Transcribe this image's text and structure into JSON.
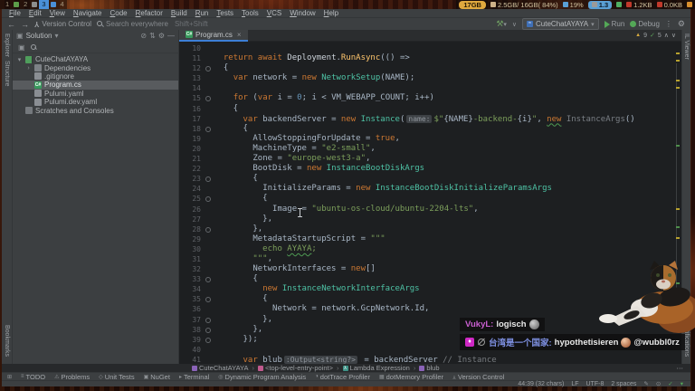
{
  "colors": {
    "accent_blue": "#3d7fd6",
    "run_green": "#54a857",
    "warning_yellow": "#d6a93f",
    "badge_magenta": "#cf28c4",
    "active_workspace_blue": "#4a90d9"
  },
  "desktop_panel": {
    "workspaces": [
      {
        "label": "1",
        "active": false
      },
      {
        "label": "2",
        "active": false
      },
      {
        "label": "3",
        "active": true
      },
      {
        "label": "4",
        "active": false
      }
    ],
    "workspace_icons": [
      "plant-icon",
      "monitor-icon",
      "document-icon"
    ],
    "stats": [
      {
        "icon": "disk-icon",
        "text": "17GB",
        "variant": "yellow"
      },
      {
        "icon": "memory-icon",
        "text": "2.5GB/ 16GB( 84%)",
        "variant": ""
      },
      {
        "icon": "cpu-icon",
        "text": "19%",
        "variant": ""
      },
      {
        "icon": "load-icon",
        "text": "1.3",
        "variant": "blue"
      },
      {
        "icon": "network-icon",
        "text": "",
        "variant": ""
      },
      {
        "icon": "download-icon",
        "text": "1.2KB",
        "variant": ""
      },
      {
        "icon": "upload-icon",
        "text": "0.0KB",
        "variant": ""
      },
      {
        "icon": "power-icon",
        "text": "",
        "variant": ""
      }
    ]
  },
  "menubar": {
    "items": [
      "File",
      "Edit",
      "View",
      "Navigate",
      "Code",
      "Refactor",
      "Build",
      "Run",
      "Tests",
      "Tools",
      "VCS",
      "Window",
      "Help"
    ]
  },
  "toolbar": {
    "back": "←",
    "forward": "→",
    "version_control_label": "Version Control",
    "search_placeholder": "Search everywhere",
    "search_shortcut": "Shift+Shift",
    "build_chevron": "∨",
    "run_config": "CuteChatAYAYA",
    "config_caret": "▾",
    "run_label": "Run",
    "debug_label": "Debug",
    "more_dots": "⋮"
  },
  "left_stripe": {
    "top": [
      "Explorer",
      "Structure"
    ],
    "bottom": [
      "Bookmarks"
    ]
  },
  "right_stripe": {
    "top": [
      "IL Viewer"
    ],
    "bottom": [
      "Notifications"
    ]
  },
  "solution_panel": {
    "title": "Solution",
    "title_caret": "▾",
    "tree": [
      {
        "label": "CuteChatAYAYA",
        "icon": "solution",
        "indent": 0,
        "chevron": "▾",
        "selected": false
      },
      {
        "label": "Dependencies",
        "icon": "dependencies",
        "indent": 1,
        "chevron": "›",
        "selected": false
      },
      {
        "label": ".gitignore",
        "icon": "file",
        "indent": 1,
        "chevron": "",
        "selected": false
      },
      {
        "label": "Program.cs",
        "icon": "csharp",
        "indent": 1,
        "chevron": "",
        "selected": true
      },
      {
        "label": "Pulumi.yaml",
        "icon": "file",
        "indent": 1,
        "chevron": "",
        "selected": false
      },
      {
        "label": "Pulumi.dev.yaml",
        "icon": "file",
        "indent": 1,
        "chevron": "",
        "selected": false
      },
      {
        "label": "Scratches and Consoles",
        "icon": "scratches",
        "indent": 0,
        "chevron": "",
        "selected": false
      }
    ]
  },
  "editor": {
    "tab": {
      "label": "Program.cs",
      "close": "×",
      "icon": "C#"
    },
    "inspections": {
      "warnings": "9",
      "passed": "5",
      "up": "∧",
      "down": "∨"
    },
    "lines": [
      {
        "n": 10,
        "t": []
      },
      {
        "n": 11,
        "t": [
          [
            "p",
            "  "
          ],
          [
            "k",
            "return"
          ],
          [
            "p",
            " "
          ],
          [
            "k",
            "await"
          ],
          [
            "p",
            " "
          ],
          [
            "t0",
            "Deployment"
          ],
          [
            "p",
            "."
          ],
          [
            "m",
            "RunAsync"
          ],
          [
            "p",
            "(() =>"
          ]
        ]
      },
      {
        "n": 12,
        "t": [
          [
            "p",
            "  {"
          ]
        ],
        "fold": true
      },
      {
        "n": 13,
        "t": [
          [
            "p",
            "    "
          ],
          [
            "k",
            "var"
          ],
          [
            "p",
            " "
          ],
          [
            "v",
            "network"
          ],
          [
            "p",
            " = "
          ],
          [
            "k",
            "new"
          ],
          [
            "p",
            " "
          ],
          [
            "t",
            "NetworkSetup"
          ],
          [
            "p",
            "("
          ],
          [
            "cst",
            "NAME"
          ],
          [
            "p",
            ");"
          ]
        ]
      },
      {
        "n": 14,
        "t": []
      },
      {
        "n": 15,
        "t": [
          [
            "p",
            "    "
          ],
          [
            "k",
            "for"
          ],
          [
            "p",
            " ("
          ],
          [
            "k",
            "var"
          ],
          [
            "p",
            " "
          ],
          [
            "v",
            "i"
          ],
          [
            "p",
            " = "
          ],
          [
            "n2",
            "0"
          ],
          [
            "p",
            "; "
          ],
          [
            "v",
            "i"
          ],
          [
            "p",
            " < "
          ],
          [
            "cst",
            "VM_WEBAPP_COUNT"
          ],
          [
            "p",
            "; "
          ],
          [
            "v",
            "i"
          ],
          [
            "p",
            "++)"
          ]
        ],
        "fold": true
      },
      {
        "n": 16,
        "t": [
          [
            "p",
            "    {"
          ]
        ]
      },
      {
        "n": 17,
        "t": [
          [
            "p",
            "      "
          ],
          [
            "k",
            "var"
          ],
          [
            "p",
            " "
          ],
          [
            "v",
            "backendServer"
          ],
          [
            "p",
            " = "
          ],
          [
            "k",
            "new"
          ],
          [
            "p",
            " "
          ],
          [
            "t",
            "Instance"
          ],
          [
            "p",
            "("
          ],
          [
            "in",
            "name:"
          ],
          [
            "s",
            "$\""
          ],
          [
            "iv",
            "{NAME}"
          ],
          [
            "s",
            "-backend-"
          ],
          [
            "iv",
            "{i}"
          ],
          [
            "s",
            "\""
          ],
          [
            "p",
            ", "
          ],
          [
            "ku",
            "new"
          ],
          [
            "p",
            " "
          ],
          [
            "tg",
            "InstanceArgs"
          ],
          [
            "p",
            "()"
          ]
        ]
      },
      {
        "n": 18,
        "t": [
          [
            "p",
            "      {"
          ]
        ],
        "fold": true
      },
      {
        "n": 19,
        "t": [
          [
            "p",
            "        "
          ],
          [
            "f",
            "AllowStoppingForUpdate"
          ],
          [
            "p",
            " = "
          ],
          [
            "k",
            "true"
          ],
          [
            "p",
            ","
          ]
        ]
      },
      {
        "n": 20,
        "t": [
          [
            "p",
            "        "
          ],
          [
            "f",
            "MachineType"
          ],
          [
            "p",
            " = "
          ],
          [
            "s",
            "\"e2-small\""
          ],
          [
            "p",
            ","
          ]
        ]
      },
      {
        "n": 21,
        "t": [
          [
            "p",
            "        "
          ],
          [
            "f",
            "Zone"
          ],
          [
            "p",
            " = "
          ],
          [
            "s",
            "\"europe-west3-a\""
          ],
          [
            "p",
            ","
          ]
        ]
      },
      {
        "n": 22,
        "t": [
          [
            "p",
            "        "
          ],
          [
            "f",
            "BootDisk"
          ],
          [
            "p",
            " = "
          ],
          [
            "k",
            "new"
          ],
          [
            "p",
            " "
          ],
          [
            "t",
            "InstanceBootDiskArgs"
          ]
        ]
      },
      {
        "n": 23,
        "t": [
          [
            "p",
            "        {"
          ]
        ],
        "fold": true
      },
      {
        "n": 24,
        "t": [
          [
            "p",
            "          "
          ],
          [
            "f",
            "InitializeParams"
          ],
          [
            "p",
            " = "
          ],
          [
            "k",
            "new"
          ],
          [
            "p",
            " "
          ],
          [
            "t",
            "InstanceBootDiskInitializeParamsArgs"
          ]
        ]
      },
      {
        "n": 25,
        "t": [
          [
            "p",
            "          {"
          ]
        ],
        "fold": true
      },
      {
        "n": 26,
        "t": [
          [
            "p",
            "            "
          ],
          [
            "f",
            "Image"
          ],
          [
            "p",
            " = "
          ],
          [
            "s",
            "\"ubuntu-os-cloud/ubuntu-2204-lts\""
          ],
          [
            "p",
            ","
          ]
        ]
      },
      {
        "n": 27,
        "t": [
          [
            "p",
            "          },"
          ]
        ]
      },
      {
        "n": 28,
        "t": [
          [
            "p",
            "        },"
          ]
        ],
        "fold": true
      },
      {
        "n": 29,
        "t": [
          [
            "p",
            "        "
          ],
          [
            "f",
            "MetadataStartupScript"
          ],
          [
            "p",
            " = "
          ],
          [
            "s",
            "\"\"\""
          ]
        ]
      },
      {
        "n": 30,
        "t": [
          [
            "s",
            "          echo "
          ],
          [
            "su",
            "AYAYA"
          ],
          [
            "s",
            ";"
          ]
        ]
      },
      {
        "n": 31,
        "t": [
          [
            "s",
            "        \"\"\""
          ],
          [
            "p",
            ","
          ]
        ]
      },
      {
        "n": 32,
        "t": [
          [
            "p",
            "        "
          ],
          [
            "f",
            "NetworkInterfaces"
          ],
          [
            "p",
            " = "
          ],
          [
            "k",
            "new"
          ],
          [
            "p",
            "[]"
          ]
        ]
      },
      {
        "n": 33,
        "t": [
          [
            "p",
            "        {"
          ]
        ],
        "fold": true
      },
      {
        "n": 34,
        "t": [
          [
            "p",
            "          "
          ],
          [
            "k",
            "new"
          ],
          [
            "p",
            " "
          ],
          [
            "t",
            "InstanceNetworkInterfaceArgs"
          ]
        ]
      },
      {
        "n": 35,
        "t": [
          [
            "p",
            "          {"
          ]
        ],
        "fold": true
      },
      {
        "n": 36,
        "t": [
          [
            "p",
            "            "
          ],
          [
            "f",
            "Network"
          ],
          [
            "p",
            " = "
          ],
          [
            "v",
            "network"
          ],
          [
            "p",
            "."
          ],
          [
            "f",
            "GcpNetwork"
          ],
          [
            "p",
            "."
          ],
          [
            "f",
            "Id"
          ],
          [
            "p",
            ","
          ]
        ]
      },
      {
        "n": 37,
        "t": [
          [
            "p",
            "          },"
          ]
        ],
        "fold": true
      },
      {
        "n": 38,
        "t": [
          [
            "p",
            "        },"
          ]
        ],
        "fold": true
      },
      {
        "n": 39,
        "t": [
          [
            "p",
            "      });"
          ]
        ],
        "fold": true
      },
      {
        "n": 40,
        "t": []
      },
      {
        "n": 41,
        "t": [
          [
            "p",
            "      "
          ],
          [
            "k",
            "var"
          ],
          [
            "p",
            " "
          ],
          [
            "vu",
            "blub"
          ],
          [
            "in",
            ":Output<string?>"
          ],
          [
            "p",
            " = "
          ],
          [
            "v",
            "backendServer"
          ],
          [
            "p",
            " "
          ],
          [
            "c",
            "// Instance"
          ]
        ]
      }
    ]
  },
  "breadcrumbs": {
    "items": [
      {
        "label": "CuteChatAYAYA",
        "icon": "project-icon",
        "color": "#8a63b8"
      },
      {
        "label": "<top-level-entry-point>",
        "icon": "entry-point-icon",
        "color": "#c05a8e"
      },
      {
        "label": "Lambda Expression",
        "icon": "lambda-icon",
        "color": "#3f9488"
      },
      {
        "label": "blub",
        "icon": "variable-icon",
        "color": "#8a63b8"
      }
    ],
    "separator": "›",
    "overflow": "⋯"
  },
  "toolwindow_bar": {
    "items": [
      {
        "label": "TODO",
        "icon": "todo-icon",
        "glyph": "≡"
      },
      {
        "label": "Problems",
        "icon": "problems-icon",
        "glyph": "⚠"
      },
      {
        "label": "Unit Tests",
        "icon": "unit-tests-icon",
        "glyph": "◇"
      },
      {
        "label": "NuGet",
        "icon": "nuget-icon",
        "glyph": "▣"
      },
      {
        "label": "Terminal",
        "icon": "terminal-icon",
        "glyph": "▸"
      },
      {
        "label": "Dynamic Program Analysis",
        "icon": "dpa-icon",
        "glyph": "◎"
      },
      {
        "label": "dotTrace Profiler",
        "icon": "dottrace-icon",
        "glyph": "◑"
      },
      {
        "label": "dotMemory Profiler",
        "icon": "dotmemory-icon",
        "glyph": "▦"
      },
      {
        "label": "Version Control",
        "icon": "version-control-icon",
        "glyph": "Y"
      }
    ]
  },
  "status_bar": {
    "caret_position": "44:39 (32 chars)",
    "line_separator": "LF",
    "encoding": "UTF-8",
    "indent": "2 spaces"
  },
  "chat": {
    "messages": [
      {
        "badges": [],
        "user": "VukyL",
        "colon": ":",
        "text": "logisch",
        "emote": "grayscale-emote",
        "mention": ""
      },
      {
        "badges": [
          "gem-badge",
          "hidden-message-icon"
        ],
        "user": "台湾是一个国家",
        "colon": ":",
        "text": "hypothetisieren",
        "emote": "face-emote",
        "mention": "@wubbl0rz"
      }
    ]
  }
}
